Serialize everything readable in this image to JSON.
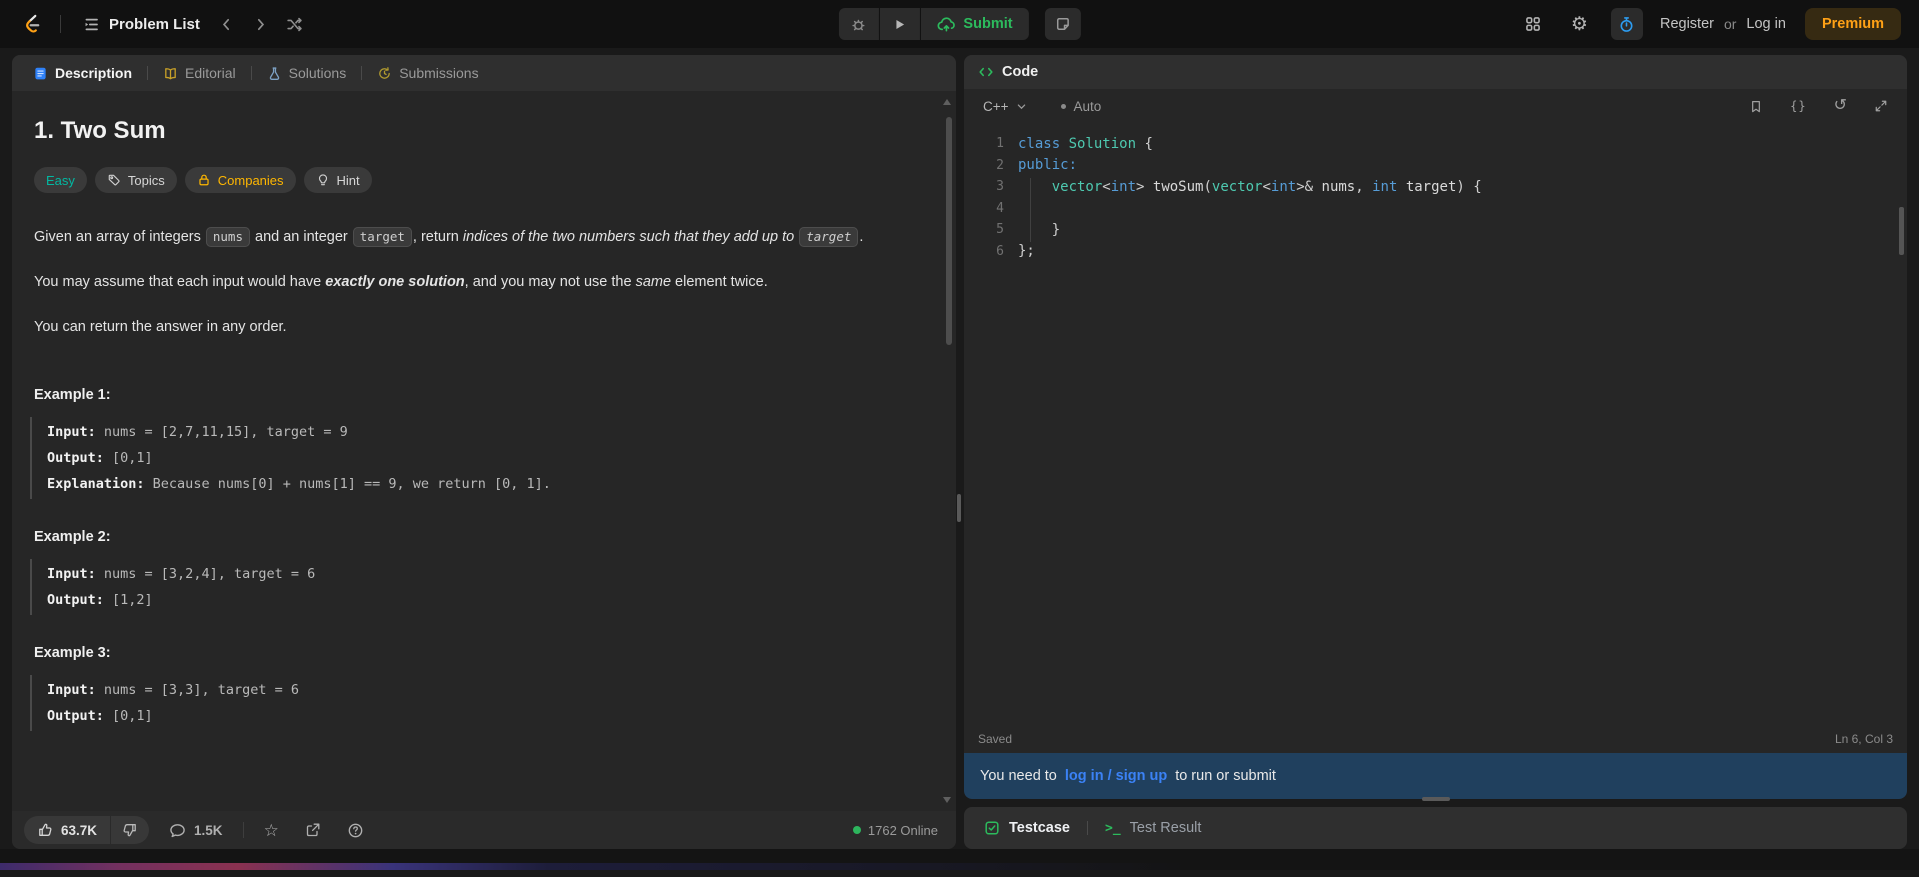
{
  "colors": {
    "accent_green": "#2cbb5d",
    "link_blue": "#3b82f6",
    "premium_orange": "#ffa116",
    "easy_teal": "#02b8a2",
    "companies_amber": "#ffb700",
    "timer_blue": "#2d9cf0",
    "online_green": "#2db55d",
    "banner_bg": "#20405e"
  },
  "icons": {
    "gear": "⚙",
    "star": "☆",
    "reset": "↺",
    "braces": "{}",
    "terminal": ">_"
  },
  "navbar": {
    "problem_list": "Problem List",
    "submit": "Submit",
    "register": "Register",
    "or": "or",
    "log_in": "Log in",
    "premium": "Premium"
  },
  "left_panel": {
    "tabs": {
      "description": "Description",
      "editorial": "Editorial",
      "solutions": "Solutions",
      "submissions": "Submissions"
    },
    "title": "1. Two Sum",
    "badges": {
      "difficulty": "Easy",
      "topics": "Topics",
      "companies": "Companies",
      "hint": "Hint"
    },
    "statement": {
      "p1": {
        "t1": "Given an array of integers ",
        "c1": "nums",
        "t2": " and an integer ",
        "c2": "target",
        "t3": ", return ",
        "em1": "indices of the two numbers such that they add up to",
        "t4": " ",
        "c3": "target",
        "t5": "."
      },
      "p2": {
        "t1": "You may assume that each input would have ",
        "b1": "exactly one solution",
        "t2": ", and you may not use the ",
        "em1": "same",
        "t3": " element twice."
      },
      "p3": "You can return the answer in any order."
    },
    "examples": {
      "e1": {
        "label": "Example 1:",
        "input_k": "Input:",
        "input_v": " nums = [2,7,11,15], target = 9",
        "output_k": "Output:",
        "output_v": " [0,1]",
        "expl_k": "Explanation:",
        "expl_v": " Because nums[0] + nums[1] == 9, we return [0, 1]."
      },
      "e2": {
        "label": "Example 2:",
        "input_k": "Input:",
        "input_v": " nums = [3,2,4], target = 6",
        "output_k": "Output:",
        "output_v": " [1,2]"
      },
      "e3": {
        "label": "Example 3:",
        "input_k": "Input:",
        "input_v": " nums = [3,3], target = 6",
        "output_k": "Output:",
        "output_v": " [0,1]"
      }
    },
    "footer": {
      "likes": "63.7K",
      "comments": "1.5K",
      "online": "1762 Online"
    }
  },
  "code_panel": {
    "header": "Code",
    "language": "C++",
    "auto": "Auto",
    "code": {
      "l1": {
        "num": "1",
        "kw": "class ",
        "ty": "Solution",
        "pl": " {"
      },
      "l2": {
        "num": "2",
        "kw": "public:"
      },
      "l3": {
        "num": "3",
        "pl0": "    ",
        "ty1": "vector",
        "pl1": "<",
        "kw1": "int",
        "pl2": "> ",
        "fn": "twoSum",
        "pl3": "(",
        "ty2": "vector",
        "pl4": "<",
        "kw2": "int",
        "pl5": ">& ",
        "va1": "nums",
        "pl6": ", ",
        "kw3": "int",
        "pl7": " ",
        "va2": "target",
        "pl8": ") {"
      },
      "l4": {
        "num": "4"
      },
      "l5": {
        "num": "5",
        "pl": "    }"
      },
      "l6": {
        "num": "6",
        "pl": "};"
      }
    },
    "saved": "Saved",
    "cursor": "Ln 6, Col 3",
    "banner": {
      "prefix": "You need to",
      "link": "log in / sign up",
      "suffix": "to run or submit"
    }
  },
  "console_panel": {
    "testcase": "Testcase",
    "test_result": "Test Result"
  }
}
